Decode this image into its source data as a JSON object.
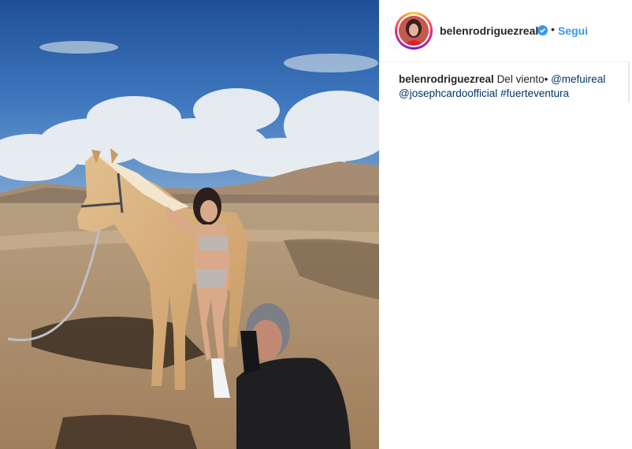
{
  "post": {
    "username": "belenrodriguezreal",
    "verified": true,
    "follow_separator": "•",
    "follow_label": "Segui",
    "caption": {
      "username": "belenrodriguezreal",
      "text": "Del viento•",
      "mention_1": "@mefuireal",
      "mention_2": "@josephcardoofficial",
      "hashtag": "#fuerteventura"
    },
    "photo_description_icon": "photo"
  },
  "colors": {
    "link_blue": "#3897f0",
    "mention_blue": "#003569",
    "text": "#262626",
    "verified_blue": "#3897f0"
  }
}
